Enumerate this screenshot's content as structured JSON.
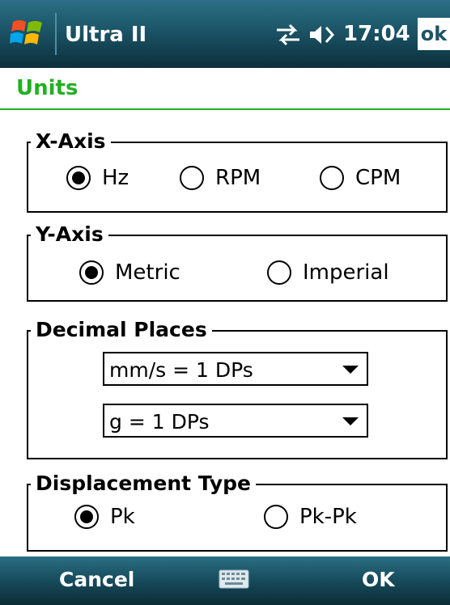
{
  "titlebar": {
    "app_title": "Ultra II",
    "time": "17:04",
    "ok_label": "ok"
  },
  "header": {
    "title": "Units"
  },
  "xaxis": {
    "legend": "X-Axis",
    "options": [
      {
        "label": "Hz",
        "selected": true
      },
      {
        "label": "RPM",
        "selected": false
      },
      {
        "label": "CPM",
        "selected": false
      }
    ]
  },
  "yaxis": {
    "legend": "Y-Axis",
    "options": [
      {
        "label": "Metric",
        "selected": true
      },
      {
        "label": "Imperial",
        "selected": false
      }
    ]
  },
  "decimal": {
    "legend": "Decimal Places",
    "velocity_value": "mm/s = 1 DPs",
    "accel_value": "g = 1 DPs"
  },
  "displacement": {
    "legend": "Displacement Type",
    "options": [
      {
        "label": "Pk",
        "selected": true
      },
      {
        "label": "Pk-Pk",
        "selected": false
      }
    ]
  },
  "softkeys": {
    "left": "Cancel",
    "right": "OK"
  },
  "colors": {
    "titlebar": "#1b5466",
    "accent_green": "#22b022"
  },
  "icons": [
    "windows-start-icon",
    "connectivity-icon",
    "volume-icon",
    "keyboard-icon",
    "chevron-down-icon"
  ]
}
